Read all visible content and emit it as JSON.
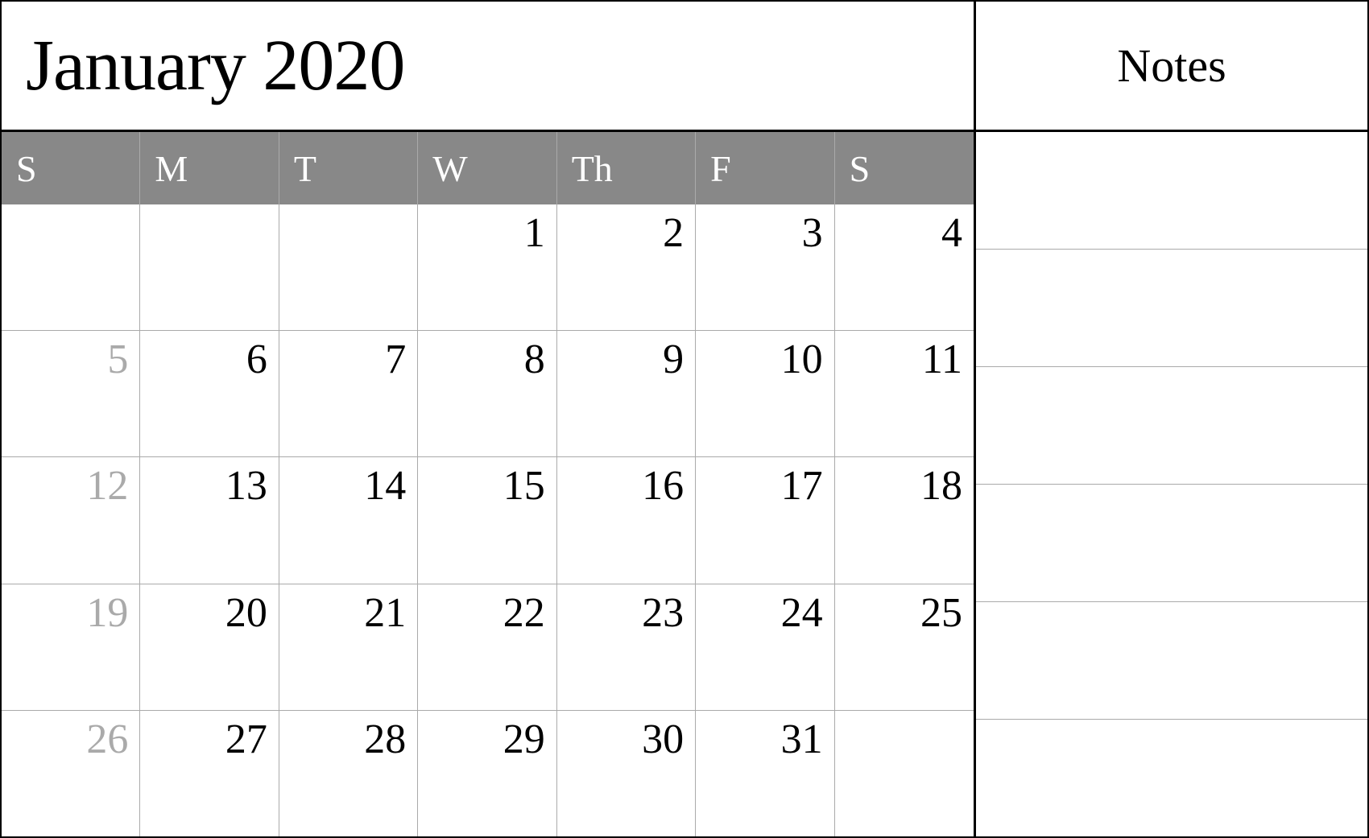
{
  "header": {
    "title": "January 2020",
    "notes_label": "Notes"
  },
  "days": {
    "headers": [
      "S",
      "M",
      "T",
      "W",
      "Th",
      "F",
      "S"
    ]
  },
  "weeks": [
    [
      {
        "day": "",
        "type": "empty"
      },
      {
        "day": "",
        "type": "empty"
      },
      {
        "day": "",
        "type": "empty"
      },
      {
        "day": "1",
        "type": "normal"
      },
      {
        "day": "2",
        "type": "normal"
      },
      {
        "day": "3",
        "type": "normal"
      },
      {
        "day": "4",
        "type": "normal"
      }
    ],
    [
      {
        "day": "5",
        "type": "sunday"
      },
      {
        "day": "6",
        "type": "normal"
      },
      {
        "day": "7",
        "type": "normal"
      },
      {
        "day": "8",
        "type": "normal"
      },
      {
        "day": "9",
        "type": "normal"
      },
      {
        "day": "10",
        "type": "normal"
      },
      {
        "day": "11",
        "type": "normal"
      }
    ],
    [
      {
        "day": "12",
        "type": "sunday"
      },
      {
        "day": "13",
        "type": "normal"
      },
      {
        "day": "14",
        "type": "normal"
      },
      {
        "day": "15",
        "type": "normal"
      },
      {
        "day": "16",
        "type": "normal"
      },
      {
        "day": "17",
        "type": "normal"
      },
      {
        "day": "18",
        "type": "normal"
      }
    ],
    [
      {
        "day": "19",
        "type": "sunday"
      },
      {
        "day": "20",
        "type": "normal"
      },
      {
        "day": "21",
        "type": "normal"
      },
      {
        "day": "22",
        "type": "normal"
      },
      {
        "day": "23",
        "type": "normal"
      },
      {
        "day": "24",
        "type": "normal"
      },
      {
        "day": "25",
        "type": "normal"
      }
    ],
    [
      {
        "day": "26",
        "type": "sunday"
      },
      {
        "day": "27",
        "type": "normal"
      },
      {
        "day": "28",
        "type": "normal"
      },
      {
        "day": "29",
        "type": "normal"
      },
      {
        "day": "30",
        "type": "normal"
      },
      {
        "day": "31",
        "type": "normal"
      },
      {
        "day": "",
        "type": "empty"
      }
    ]
  ]
}
